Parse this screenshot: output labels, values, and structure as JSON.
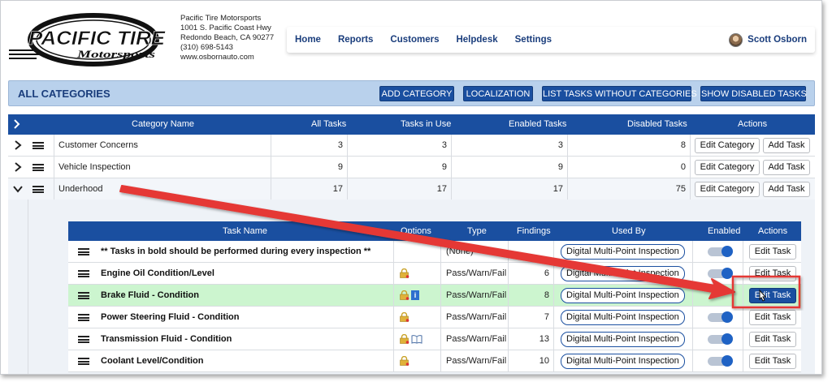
{
  "company": {
    "name": "Pacific Tire Motorsports",
    "street": "1001 S. Pacific Coast Hwy",
    "city": "Redondo Beach, CA 90277",
    "phone": "(310) 698-5143",
    "website": "www.osbornauto.com",
    "logo_line1": "PACIFIC TIRE",
    "logo_line2": "Motorsports"
  },
  "nav": {
    "items": [
      "Home",
      "Reports",
      "Customers",
      "Helpdesk",
      "Settings"
    ],
    "user_name": "Scott Osborn"
  },
  "category_bar": {
    "title": "ALL CATEGORIES",
    "buttons": {
      "add_category": "ADD CATEGORY",
      "localization": "LOCALIZATION",
      "list_tasks": "LIST TASKS WITHOUT CATEGORIES",
      "show_disabled": "SHOW DISABLED TASKS"
    }
  },
  "categories_table": {
    "headers": {
      "name": "Category Name",
      "all": "All Tasks",
      "in_use": "Tasks in Use",
      "enabled": "Enabled Tasks",
      "disabled": "Disabled Tasks",
      "actions": "Actions"
    },
    "edit_label": "Edit Category",
    "add_label": "Add Task",
    "rows": [
      {
        "name": "Customer Concerns",
        "all": "3",
        "in_use": "3",
        "enabled": "3",
        "disabled": "8",
        "expanded": false
      },
      {
        "name": "Vehicle Inspection",
        "all": "9",
        "in_use": "9",
        "enabled": "9",
        "disabled": "0",
        "expanded": false
      },
      {
        "name": "Underhood",
        "all": "17",
        "in_use": "17",
        "enabled": "17",
        "disabled": "75",
        "expanded": true
      }
    ]
  },
  "tasks_table": {
    "headers": {
      "name": "Task Name",
      "options": "Options",
      "type": "Type",
      "findings": "Findings",
      "used_by": "Used By",
      "enabled": "Enabled",
      "actions": "Actions"
    },
    "edit_label": "Edit Task",
    "rows": [
      {
        "name": "** Tasks in bold should be performed during every inspection **",
        "type": "(None)",
        "findings": "",
        "used_by": "Digital Multi-Point Inspection",
        "icons": []
      },
      {
        "name": "Engine Oil Condition/Level",
        "type": "Pass/Warn/Fail",
        "findings": "6",
        "used_by": "Digital Multi-Point Inspection",
        "icons": [
          "lock-icon"
        ]
      },
      {
        "name": "Brake Fluid - Condition",
        "type": "Pass/Warn/Fail",
        "findings": "8",
        "used_by": "Digital Multi-Point Inspection",
        "icons": [
          "lock-icon",
          "info-icon"
        ]
      },
      {
        "name": "Power Steering Fluid - Condition",
        "type": "Pass/Warn/Fail",
        "findings": "7",
        "used_by": "Digital Multi-Point Inspection",
        "icons": [
          "lock-icon"
        ]
      },
      {
        "name": "Transmission Fluid - Condition",
        "type": "Pass/Warn/Fail",
        "findings": "13",
        "used_by": "Digital Multi-Point Inspection",
        "icons": [
          "lock-icon",
          "book-icon"
        ]
      },
      {
        "name": "Coolant Level/Condition",
        "type": "Pass/Warn/Fail",
        "findings": "10",
        "used_by": "Digital Multi-Point Inspection",
        "icons": [
          "lock-icon"
        ]
      }
    ]
  },
  "colors": {
    "primary": "#1a4fa0",
    "nav_text": "#1a3d7c",
    "category_bar": "#b9d1ec",
    "highlight_row": "#ccf5cf",
    "annotation": "#e53935"
  }
}
